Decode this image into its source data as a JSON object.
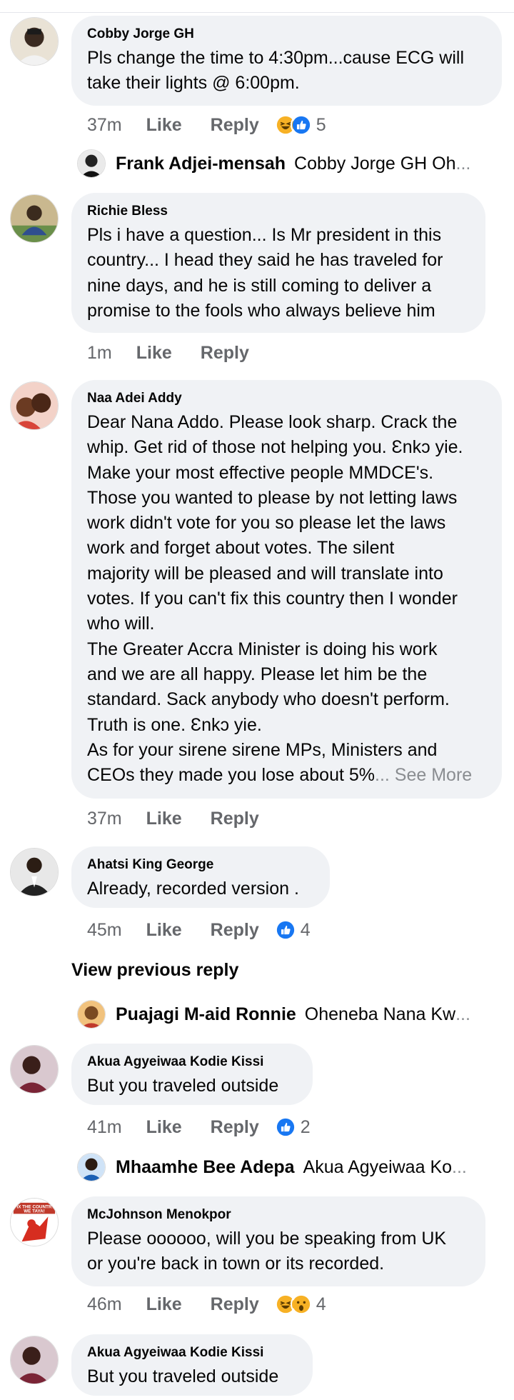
{
  "comments": [
    {
      "author": "Cobby Jorge GH",
      "text": "Pls change the time to 4:30pm...cause ECG will\ntake their lights  @ 6:00pm.",
      "time": "37m",
      "like": "Like",
      "reply": "Reply",
      "reaction_count": "5",
      "reactions": [
        "haha-icon",
        "like-icon"
      ]
    },
    {
      "author": "Richie Bless",
      "text": "Pls i have a question... Is Mr president in this\ncountry... I head they said he has traveled for\nnine days, and he is still coming to deliver a\npromise to the fools who always believe him",
      "time": "1m",
      "like": "Like",
      "reply": "Reply"
    },
    {
      "author": "Naa Adei Addy",
      "text": "Dear Nana Addo. Please look sharp. Crack the\nwhip. Get rid of those not helping you. Ɛnkɔ yie.\nMake your most effective people MMDCE's.\nThose you wanted to please by not letting laws\nwork didn't vote for you so please let the laws\nwork and forget about votes. The silent\nmajority will be pleased and will translate into\nvotes. If you can't fix this country then I wonder\nwho will.\nThe Greater Accra Minister is doing his work\nand we are all happy. Please let him be the\nstandard. Sack anybody who doesn't perform.\nTruth is one. Ɛnkɔ yie.\nAs for your sirene sirene MPs, Ministers and\nCEOs they made you lose about 5%",
      "see_more": "... See More",
      "time": "37m",
      "like": "Like",
      "reply": "Reply"
    },
    {
      "author": "Ahatsi King George",
      "text": "Already, recorded version .",
      "time": "45m",
      "like": "Like",
      "reply": "Reply",
      "reaction_count": "4",
      "reactions": [
        "like-icon"
      ]
    },
    {
      "author": "Akua Agyeiwaa Kodie Kissi",
      "text": "But you traveled outside",
      "time": "41m",
      "like": "Like",
      "reply": "Reply",
      "reaction_count": "2",
      "reactions": [
        "like-icon"
      ]
    },
    {
      "author": "McJohnson Menokpor",
      "text": "Please oooooo, will you be speaking from UK\nor you're back in town or its recorded.",
      "time": "46m",
      "like": "Like",
      "reply": "Reply",
      "reaction_count": "4",
      "reactions": [
        "haha-icon",
        "wow-icon"
      ]
    },
    {
      "author": "Akua Agyeiwaa Kodie Kissi",
      "text": "But you traveled outside"
    }
  ],
  "replies": [
    {
      "author": "Frank Adjei-mensah",
      "snippet": "Cobby Jorge GH  Oh",
      "ellipsis": "..."
    },
    {
      "author": "Puajagi M-aid Ronnie",
      "snippet": "Oheneba Nana Kw",
      "ellipsis": "..."
    },
    {
      "author": "Mhaamhe Bee Adepa",
      "snippet": "Akua Agyeiwaa Ko",
      "ellipsis": "..."
    }
  ],
  "view_previous_reply": "View previous reply",
  "avatar_badge_text": "FIX THE COUNTRY\nWE TAYA!",
  "colors": {
    "bubble": "#f0f2f5",
    "meta_text": "#65676b",
    "like_blue": "#1877f2",
    "haha_yellow": "#f7b125",
    "see_more": "#8a8d91"
  }
}
